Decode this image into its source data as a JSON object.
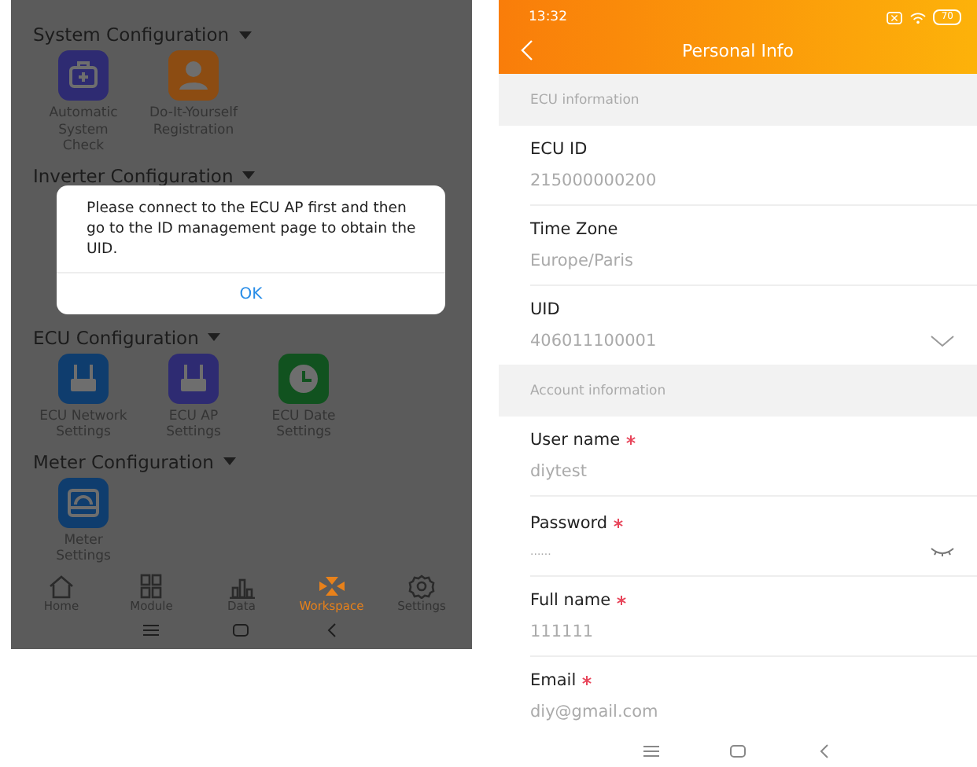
{
  "left_screen": {
    "sections": [
      {
        "title": "System Configuration",
        "items": [
          {
            "label": "Automatic System Check",
            "color": "#2e2b72"
          },
          {
            "label": "Do-It-Yourself Registration",
            "color": "#8c4c12"
          }
        ]
      },
      {
        "title": "Inverter Configuration"
      },
      {
        "title": "ECU Configuration",
        "items": [
          {
            "label": "ECU Network Settings",
            "color": "#0f3d6e"
          },
          {
            "label": "ECU AP Settings",
            "color": "#2e2b72"
          },
          {
            "label": "ECU Date Settings",
            "color": "#11521f"
          }
        ]
      },
      {
        "title": "Meter Configuration",
        "items": [
          {
            "label": "Meter Settings",
            "color": "#0f3d6e"
          }
        ]
      }
    ],
    "dialog": {
      "message": "Please connect to the ECU AP first and then go to the ID management page to obtain the UID.",
      "button": "OK"
    },
    "tabs": [
      {
        "label": "Home",
        "selected": false
      },
      {
        "label": "Module",
        "selected": false
      },
      {
        "label": "Data",
        "selected": false
      },
      {
        "label": "Workspace",
        "selected": true
      },
      {
        "label": "Settings",
        "selected": false
      }
    ]
  },
  "right_screen": {
    "status_bar": {
      "time": "13:32",
      "battery": "70"
    },
    "title": "Personal Info",
    "sections": [
      {
        "title": "ECU information",
        "fields": [
          {
            "label": "ECU ID",
            "value": "215000000200",
            "kind": "text",
            "required": false
          },
          {
            "label": "Time Zone",
            "value": "Europe/Paris",
            "kind": "text",
            "required": false
          },
          {
            "label": "UID",
            "value": "406011100001",
            "kind": "select",
            "required": false
          }
        ]
      },
      {
        "title": "Account information",
        "fields": [
          {
            "label": "User name",
            "value": "diytest",
            "kind": "text",
            "required": true
          },
          {
            "label": "Password",
            "value": "......",
            "kind": "password",
            "required": true
          },
          {
            "label": "Full name",
            "value": "111111",
            "kind": "text",
            "required": true
          },
          {
            "label": "Email",
            "value": "diy@gmail.com",
            "kind": "text",
            "required": true
          }
        ]
      }
    ]
  }
}
